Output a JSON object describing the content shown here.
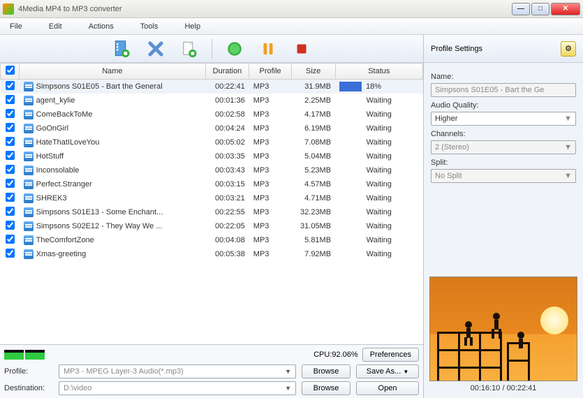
{
  "window": {
    "title": "4Media MP4 to MP3 converter"
  },
  "menu": {
    "file": "File",
    "edit": "Edit",
    "actions": "Actions",
    "tools": "Tools",
    "help": "Help"
  },
  "columns": {
    "name": "Name",
    "duration": "Duration",
    "profile": "Profile",
    "size": "Size",
    "status": "Status"
  },
  "files": [
    {
      "name": "Simpsons S01E05 - Bart the General",
      "duration": "00:22:41",
      "profile": "MP3",
      "size": "31.9MB",
      "status": "18%",
      "progress": true,
      "selected": true
    },
    {
      "name": "agent_kylie",
      "duration": "00:01:36",
      "profile": "MP3",
      "size": "2.25MB",
      "status": "Waiting"
    },
    {
      "name": "ComeBackToMe",
      "duration": "00:02:58",
      "profile": "MP3",
      "size": "4.17MB",
      "status": "Waiting"
    },
    {
      "name": "GoOnGirl",
      "duration": "00:04:24",
      "profile": "MP3",
      "size": "6.19MB",
      "status": "Waiting"
    },
    {
      "name": "HateThatILoveYou",
      "duration": "00:05:02",
      "profile": "MP3",
      "size": "7.08MB",
      "status": "Waiting"
    },
    {
      "name": "HotStuff",
      "duration": "00:03:35",
      "profile": "MP3",
      "size": "5.04MB",
      "status": "Waiting"
    },
    {
      "name": "Inconsolable",
      "duration": "00:03:43",
      "profile": "MP3",
      "size": "5.23MB",
      "status": "Waiting"
    },
    {
      "name": "Perfect.Stranger",
      "duration": "00:03:15",
      "profile": "MP3",
      "size": "4.57MB",
      "status": "Waiting"
    },
    {
      "name": "SHREK3",
      "duration": "00:03:21",
      "profile": "MP3",
      "size": "4.71MB",
      "status": "Waiting"
    },
    {
      "name": "Simpsons S01E13 - Some Enchant...",
      "duration": "00:22:55",
      "profile": "MP3",
      "size": "32.23MB",
      "status": "Waiting"
    },
    {
      "name": "Simpsons S02E12 - They Way We ...",
      "duration": "00:22:05",
      "profile": "MP3",
      "size": "31.05MB",
      "status": "Waiting"
    },
    {
      "name": "TheComfortZone",
      "duration": "00:04:08",
      "profile": "MP3",
      "size": "5.81MB",
      "status": "Waiting"
    },
    {
      "name": "Xmas-greeting",
      "duration": "00:05:38",
      "profile": "MP3",
      "size": "7.92MB",
      "status": "Waiting"
    }
  ],
  "bottom": {
    "cpu_label": "CPU:92.06%",
    "preferences": "Preferences",
    "profile_label": "Profile:",
    "profile_value": "MP3 - MPEG Layer-3 Audio(*.mp3)",
    "browse": "Browse",
    "save_as": "Save As...",
    "destination_label": "Destination:",
    "destination_value": "D:\\video",
    "open": "Open"
  },
  "panel": {
    "title": "Profile Settings",
    "name_label": "Name:",
    "name_value": "Simpsons S01E05 - Bart the Ge",
    "quality_label": "Audio Quality:",
    "quality_value": "Higher",
    "channels_label": "Channels:",
    "channels_value": "2 (Stereo)",
    "split_label": "Split:",
    "split_value": "No Split",
    "preview_time": "00:16:10 / 00:22:41"
  }
}
